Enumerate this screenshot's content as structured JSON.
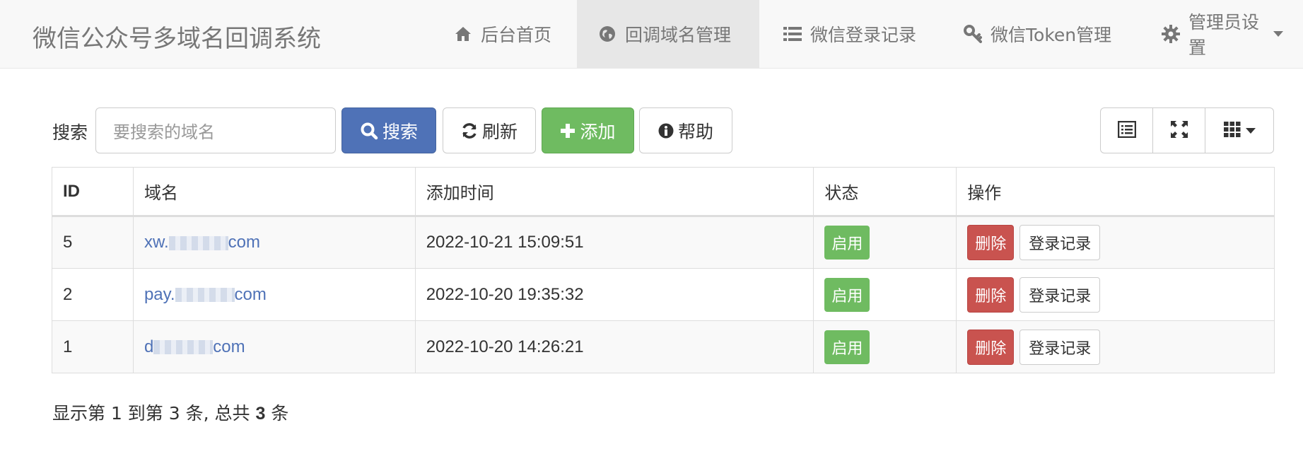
{
  "navbar": {
    "brand": "微信公众号多域名回调系统",
    "items": [
      {
        "label": "后台首页",
        "icon": "home-icon"
      },
      {
        "label": "回调域名管理",
        "icon": "globe-icon",
        "active": true
      },
      {
        "label": "微信登录记录",
        "icon": "list-icon"
      },
      {
        "label": "微信Token管理",
        "icon": "key-icon"
      },
      {
        "label": "管理员设置",
        "icon": "gear-icon"
      }
    ]
  },
  "toolbar": {
    "search_label": "搜索",
    "search_placeholder": "要搜索的域名",
    "search_button": "搜索",
    "refresh_button": "刷新",
    "add_button": "添加",
    "help_button": "帮助",
    "view_tools": [
      "list-view-icon",
      "fullscreen-icon",
      "columns-icon"
    ]
  },
  "table": {
    "headers": [
      "ID",
      "域名",
      "添加时间",
      "状态",
      "操作"
    ],
    "rows": [
      {
        "id": "5",
        "domain_prefix": "xw.",
        "domain_suffix": "com",
        "time": "2022-10-21 15:09:51",
        "status": "启用",
        "delete": "删除",
        "log": "登录记录"
      },
      {
        "id": "2",
        "domain_prefix": "pay.",
        "domain_suffix": "com",
        "time": "2022-10-20 19:35:32",
        "status": "启用",
        "delete": "删除",
        "log": "登录记录"
      },
      {
        "id": "1",
        "domain_prefix": "d",
        "domain_suffix": "com",
        "time": "2022-10-20 14:26:21",
        "status": "启用",
        "delete": "删除",
        "log": "登录记录"
      }
    ]
  },
  "pagination": {
    "text_1": "显示第 ",
    "from": "1",
    "text_2": " 到第 ",
    "to": "3",
    "text_3": " 条, 总共 ",
    "total": "3",
    "text_4": " 条"
  },
  "colors": {
    "primary": "#4f72b7",
    "success": "#6fbb61",
    "danger": "#c9534f"
  }
}
